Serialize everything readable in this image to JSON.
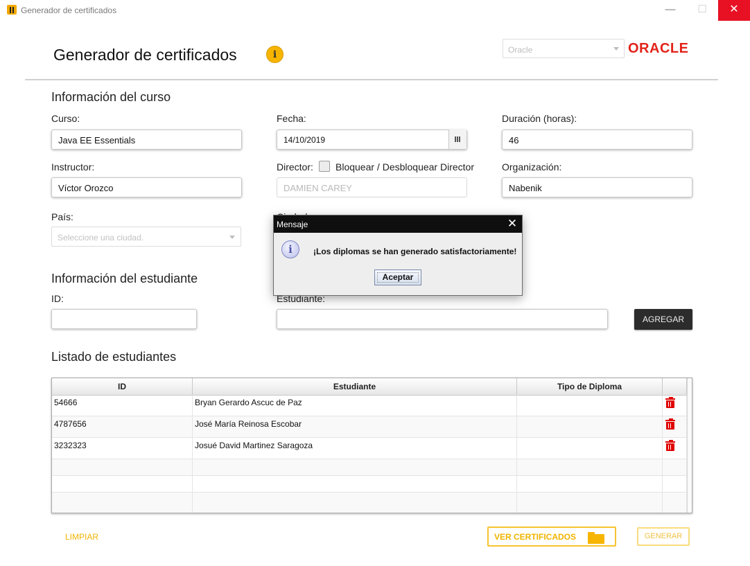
{
  "window": {
    "title": "Generador de certificados",
    "minimize": "—",
    "maximize": "☐",
    "close": "✕"
  },
  "header": {
    "heading": "Generador de certificados",
    "info_icon": "i",
    "db_select": {
      "placeholder": "Oracle"
    },
    "logo": "ORACLE"
  },
  "curso_section": {
    "title": "Información del curso",
    "curso_label": "Curso:",
    "curso_value": "Java EE Essentials",
    "fecha_label": "Fecha:",
    "fecha_value": "14/10/2019",
    "duracion_label": "Duración (horas):",
    "duracion_value": "46",
    "instructor_label": "Instructor:",
    "instructor_value": "Víctor Orozco",
    "director_label": "Director:",
    "director_toggle_label": "Bloquear / Desbloquear Director",
    "director_value": "DAMIEN CAREY",
    "organizacion_label": "Organización:",
    "organizacion_value": "Nabenik",
    "pais_label": "País:",
    "pais_placeholder": "Seleccione una ciudad.",
    "ciudad_label": "Ciudad:"
  },
  "estudiante_section": {
    "title": "Información del estudiante",
    "id_label": "ID:",
    "id_value": "",
    "estudiante_label": "Estudiante:",
    "estudiante_value": "",
    "agregar_label": "AGREGAR"
  },
  "listado": {
    "title": "Listado de estudiantes",
    "columns": [
      "ID",
      "Estudiante",
      "Tipo de Diploma"
    ],
    "rows": [
      {
        "id": "54666",
        "nombre": "Bryan Gerardo Ascuc de Paz",
        "tipo": ""
      },
      {
        "id": "4787656",
        "nombre": "José María Reinosa Escobar",
        "tipo": ""
      },
      {
        "id": "3232323",
        "nombre": "Josué David Martinez Saragoza",
        "tipo": ""
      }
    ]
  },
  "footer": {
    "limpiar_label": "LIMPIAR",
    "ver_certificados_label": "VER CERTIFICADOS",
    "generar_label": "GENERAR"
  },
  "dialog": {
    "title": "Mensaje",
    "close": "✕",
    "icon": "i",
    "message": "¡Los diplomas se han generado satisfactoriamente!",
    "ok_label": "Aceptar"
  },
  "icons": {
    "app": "app-logo-icon",
    "info": "info-icon",
    "calendar": "calendar-icon",
    "delete": "trash-icon",
    "folder": "folder-icon",
    "dialog": "information-icon"
  },
  "colors": {
    "accent": "#f0b400",
    "oracle_red": "#e2231a",
    "delete_red": "#e00000",
    "close_red": "#e81123",
    "dark_button": "#2c2c2c"
  }
}
